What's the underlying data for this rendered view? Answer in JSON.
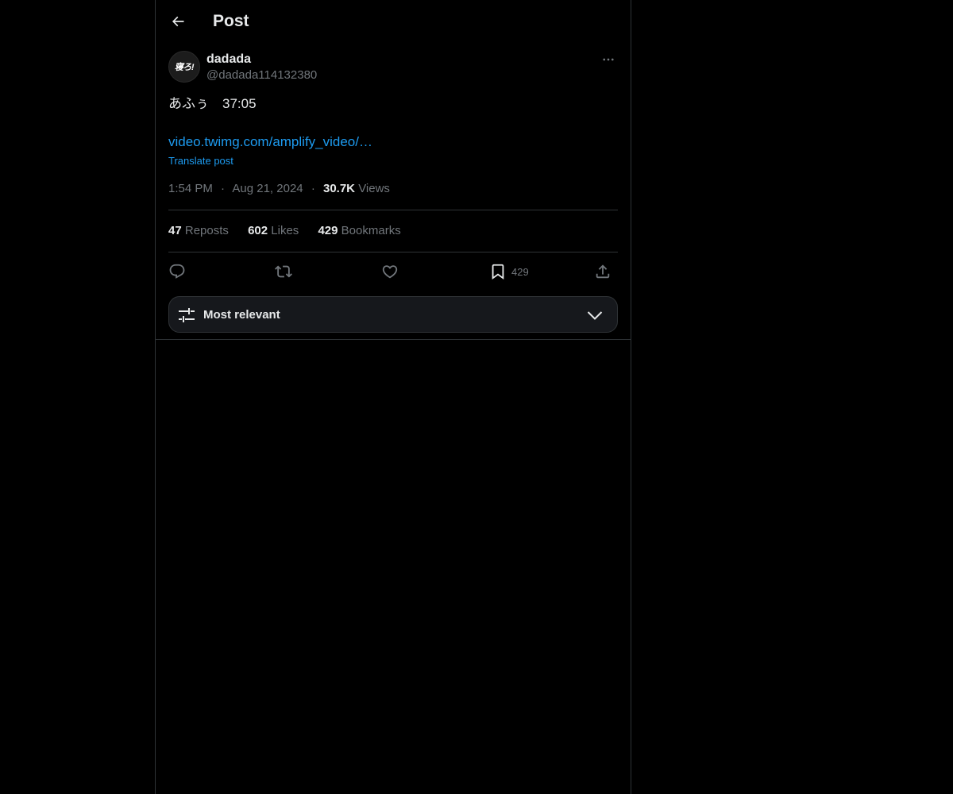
{
  "header": {
    "title": "Post",
    "back_icon": "arrow-left-icon"
  },
  "author": {
    "avatar_text": "寝ろ!",
    "display_name": "dadada",
    "handle": "@dadada114132380",
    "more_icon": "more-horizontal-icon"
  },
  "post": {
    "text": "あふぅ　37:05",
    "link": "video.twimg.com/amplify_video/…",
    "translate_label": "Translate post",
    "time": "1:54 PM",
    "date": "Aug 21, 2024",
    "separator": "·",
    "views_count": "30.7K",
    "views_label": "Views"
  },
  "stats": {
    "reposts_count": "47",
    "reposts_label": "Reposts",
    "likes_count": "602",
    "likes_label": "Likes",
    "bookmarks_count": "429",
    "bookmarks_label": "Bookmarks"
  },
  "actions": {
    "reply_icon": "reply-icon",
    "repost_icon": "repost-icon",
    "like_icon": "heart-icon",
    "bookmark_icon": "bookmark-icon",
    "bookmark_count": "429",
    "share_icon": "share-icon"
  },
  "sort": {
    "label": "Most relevant",
    "icon": "sliders-icon",
    "chevron": "chevron-down-icon"
  },
  "colors": {
    "background": "#000000",
    "text_primary": "#e7e9ea",
    "text_secondary": "#71767b",
    "accent": "#1d9bf0",
    "border": "#2f3336"
  }
}
